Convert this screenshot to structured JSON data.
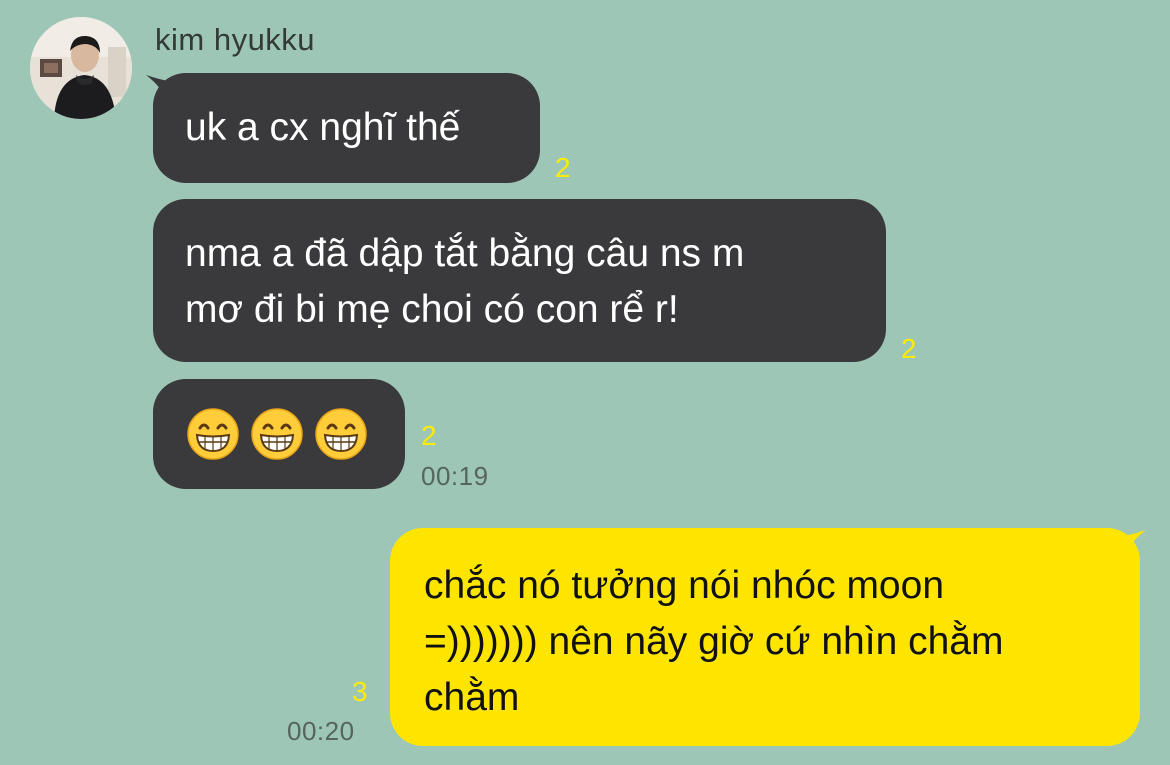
{
  "contact": {
    "name": "kim hyukku",
    "avatar_icon": "profile-photo"
  },
  "messages": [
    {
      "direction": "incoming",
      "text": "uk a cx nghĩ thế",
      "unread": "2"
    },
    {
      "direction": "incoming",
      "lines": [
        "nma a đã dập tắt bằng câu ns m",
        "mơ đi bi mẹ choi có con rể r!"
      ],
      "unread": "2"
    },
    {
      "direction": "incoming",
      "emojis": [
        "grinning-face-with-smiling-eyes",
        "grinning-face-with-smiling-eyes",
        "grinning-face-with-smiling-eyes"
      ],
      "unread": "2",
      "time": "00:19"
    },
    {
      "direction": "outgoing",
      "lines": [
        "chắc nó tưởng nói nhóc moon",
        "=))))))) nên nãy giờ cứ nhìn chằm",
        "chằm"
      ],
      "unread": "3",
      "time": "00:20"
    }
  ],
  "colors": {
    "background": "#9dc6b6",
    "incoming_bubble": "#3a3a3c",
    "outgoing_bubble": "#fee500",
    "unread_count": "#fcec00"
  }
}
